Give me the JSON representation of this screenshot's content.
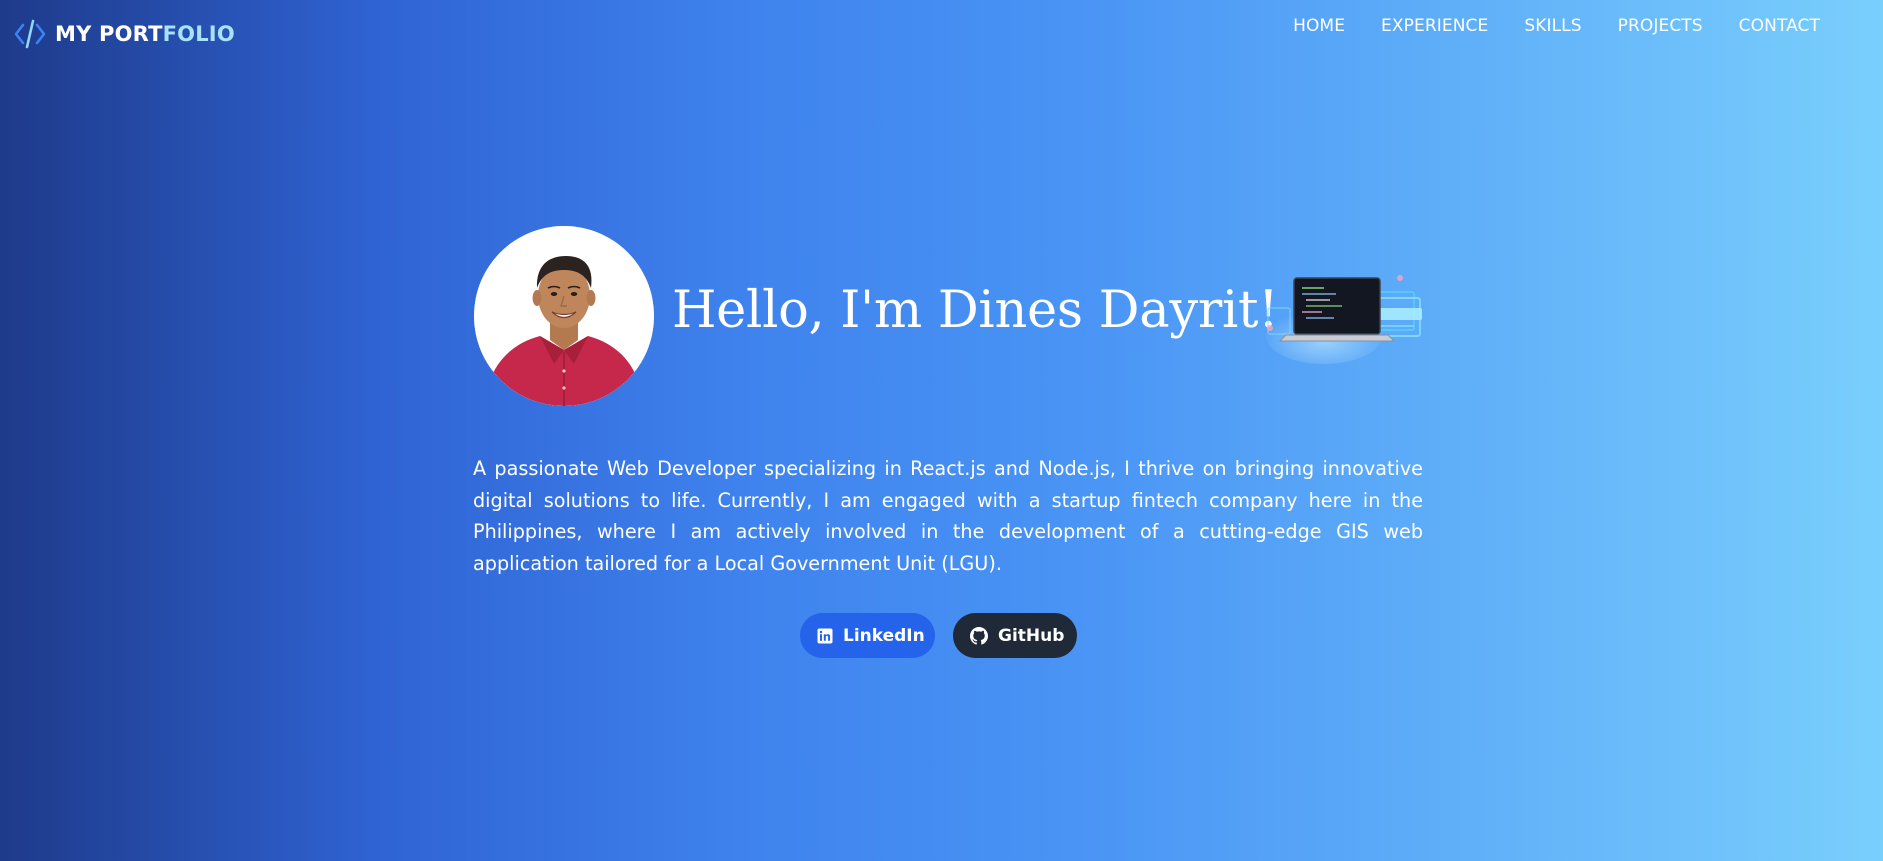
{
  "header": {
    "brand_part_a": "MY PORT",
    "brand_part_b": "FOLIO",
    "brand_icon": "code-brackets-icon",
    "nav": [
      {
        "label": "HOME"
      },
      {
        "label": "EXPERIENCE"
      },
      {
        "label": "SKILLS"
      },
      {
        "label": "PROJECTS"
      },
      {
        "label": "CONTACT"
      }
    ]
  },
  "hero": {
    "title": "Hello, I'm Dines Dayrit!",
    "bio": "A passionate Web Developer specializing in React.js and Node.js, I thrive on bringing innovative digital solutions to life. Currently, I am engaged with a startup fintech company here in the Philippines, where I am actively involved in the development of a cutting-edge GIS web application tailored for a Local Government Unit (LGU).",
    "buttons": {
      "linkedin": {
        "label": "LinkedIn",
        "icon": "linkedin-icon"
      },
      "github": {
        "label": "GitHub",
        "icon": "github-icon"
      }
    }
  },
  "colors": {
    "gradient_start": "#1e3a8a",
    "gradient_mid": "#4a95f5",
    "gradient_end": "#79cffc",
    "linkedin_button": "#2563eb",
    "github_button": "#1f2937",
    "brand_accent": "#a8e2ff"
  }
}
